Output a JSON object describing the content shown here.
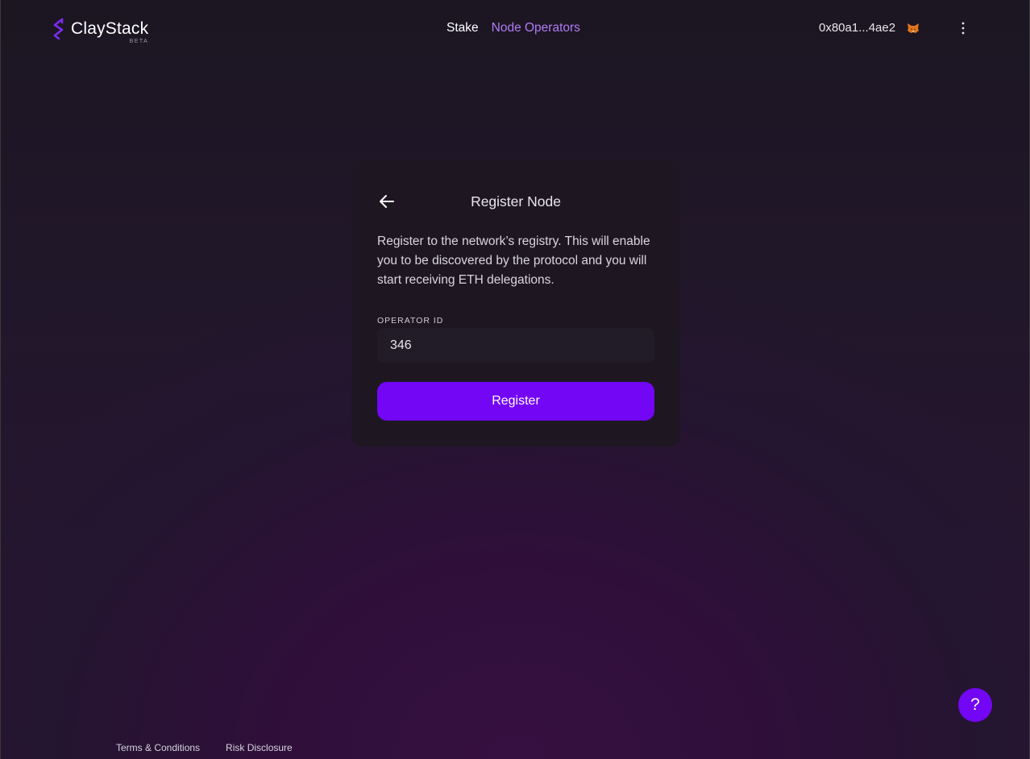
{
  "header": {
    "logo_text": "ClayStack",
    "logo_badge": "BETA",
    "nav": {
      "stake": "Stake",
      "node_operators": "Node Operators"
    },
    "wallet_address": "0x80a1...4ae2"
  },
  "register_card": {
    "title": "Register Node",
    "description": "Register to the network’s registry. This will enable you to be discovered by the protocol and you will start receiving ETH delegations.",
    "operator_id_label": "OPERATOR ID",
    "operator_id_value": "346",
    "register_button": "Register"
  },
  "footer": {
    "terms": "Terms & Conditions",
    "risk": "Risk Disclosure"
  },
  "help_button": "?",
  "icons": {
    "logo": "claystack-logo-icon",
    "back": "arrow-left-icon",
    "wallet": "metamask-fox-icon",
    "menu": "kebab-menu-icon"
  },
  "colors": {
    "accent": "#7306f5",
    "nav_active": "#b07cf2",
    "logo_mark": "#7a2cf0"
  }
}
